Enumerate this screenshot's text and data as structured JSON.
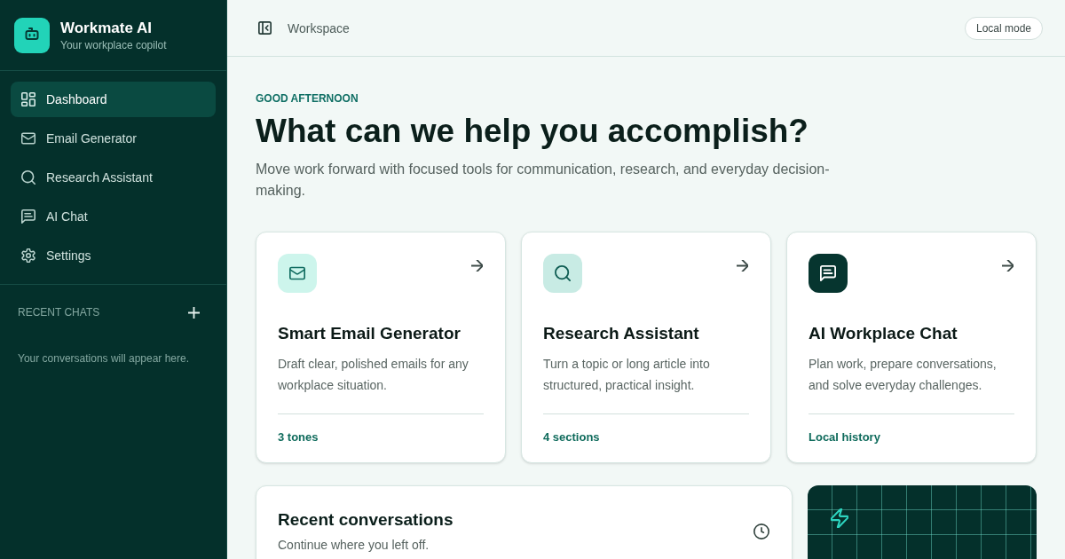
{
  "sidebar": {
    "brand": {
      "title": "Workmate AI",
      "subtitle": "Your workplace copilot"
    },
    "nav": [
      {
        "kind": "dashboard",
        "label": "Dashboard",
        "selected": true
      },
      {
        "kind": "email",
        "label": "Email Generator",
        "selected": false
      },
      {
        "kind": "research",
        "label": "Research Assistant",
        "selected": false
      },
      {
        "kind": "chat",
        "label": "AI Chat",
        "selected": false
      },
      {
        "kind": "settings",
        "label": "Settings",
        "selected": false
      }
    ],
    "recent_chats": {
      "heading": "RECENT CHATS",
      "empty_text": "Your conversations will appear here."
    }
  },
  "topbar": {
    "title": "Workspace",
    "badge": "Local mode"
  },
  "hero": {
    "eyebrow": "GOOD AFTERNOON",
    "heading": "What can we help you accomplish?",
    "text": "Move work forward with focused tools for communication, research, and everyday decision-making."
  },
  "tools": [
    {
      "kind": "email",
      "title": "Smart Email Generator",
      "description": "Draft clear, polished emails for any workplace situation.",
      "footer": "3 tones"
    },
    {
      "kind": "research",
      "title": "Research Assistant",
      "description": "Turn a topic or long article into structured, practical insight.",
      "footer": "4 sections"
    },
    {
      "kind": "chat",
      "title": "AI Workplace Chat",
      "description": "Plan work, prepare conversations, and solve everyday challenges.",
      "footer": "Local history"
    }
  ],
  "recent_conversations": {
    "title": "Recent conversations",
    "subtitle": "Continue where you left off."
  }
}
